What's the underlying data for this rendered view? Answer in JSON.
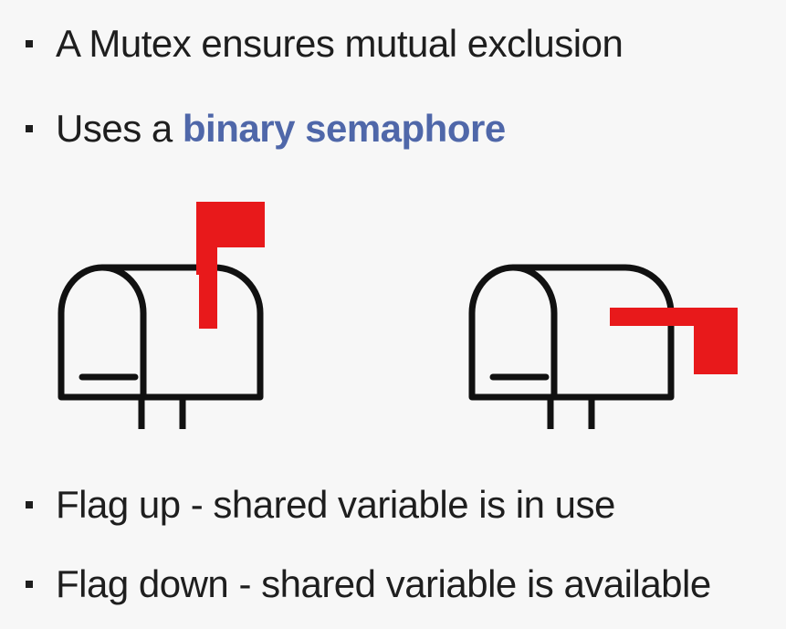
{
  "bullets": [
    {
      "text": "A Mutex ensures mutual exclusion"
    },
    {
      "prefix": "Uses a ",
      "highlight": "binary semaphore"
    },
    {
      "text": "Flag up - shared variable is in use"
    },
    {
      "text": "Flag down - shared variable is available"
    }
  ],
  "illustrations": {
    "left": {
      "icon": "mailbox-flag-up-icon"
    },
    "right": {
      "icon": "mailbox-flag-down-icon"
    }
  },
  "colors": {
    "background": "#f7f7f7",
    "text": "#1e1e1e",
    "highlight": "#4f67a9",
    "flag": "#e8191b",
    "outline": "#111111"
  }
}
